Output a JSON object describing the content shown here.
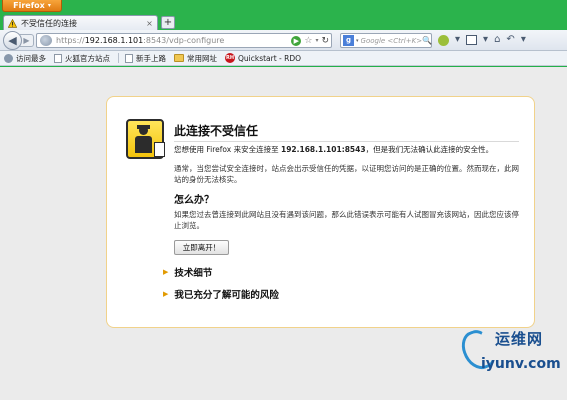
{
  "browser": {
    "menu_button_label": "Firefox",
    "menu_caret": "▾"
  },
  "tab": {
    "title": "不受信任的连接",
    "close_glyph": "×",
    "new_tab_glyph": "+"
  },
  "navigation": {
    "back_glyph": "◀",
    "forward_glyph": "▶",
    "url": {
      "protocol": "https://",
      "host": "192.168.1.101",
      "path": ":8543/vdp-configure"
    },
    "go_glyph": "▶",
    "bookmark_glyph": "☆",
    "dropdown_glyph": "▾",
    "refresh_glyph": "↻",
    "search": {
      "engine_letter": "g",
      "placeholder": "Google <Ctrl+K>",
      "search_glyph": "🔍"
    },
    "home_glyph": "⌂",
    "undo_glyph": "↶",
    "more_glyph": "▾"
  },
  "bookmarks": [
    {
      "label": "访问最多",
      "icon": "gear"
    },
    {
      "label": "火狐官方站点",
      "icon": "page"
    },
    {
      "label": "新手上路",
      "icon": "page"
    },
    {
      "label": "常用网址",
      "icon": "folder"
    },
    {
      "label": "Quickstart - RDO",
      "icon": "redhat"
    }
  ],
  "redhat_badge": "RH",
  "error_page": {
    "title": "此连接不受信任",
    "description_prefix": "您想使用 Firefox 来安全连接至 ",
    "description_host": "192.168.1.101:8543",
    "description_suffix": "，但是我们无法确认此连接的安全性。",
    "detail": "通常，当您尝试安全连接时，站点会出示受信任的凭据，以证明您访问的是正确的位置。然而现在，此网站的身份无法核实。",
    "subtitle": "怎么办？",
    "advice": "如果您过去曾连接到此网站且没有遇到该问题，那么此错误表示可能有人试图冒充该网站，因此您应该停止浏览。",
    "leave_button": "立即离开！",
    "expander_technical": "技术细节",
    "expander_risks": "我已充分了解可能的风险",
    "expander_glyph": "▶"
  },
  "watermark": {
    "title": "运维网",
    "url": "iyunv.com"
  }
}
